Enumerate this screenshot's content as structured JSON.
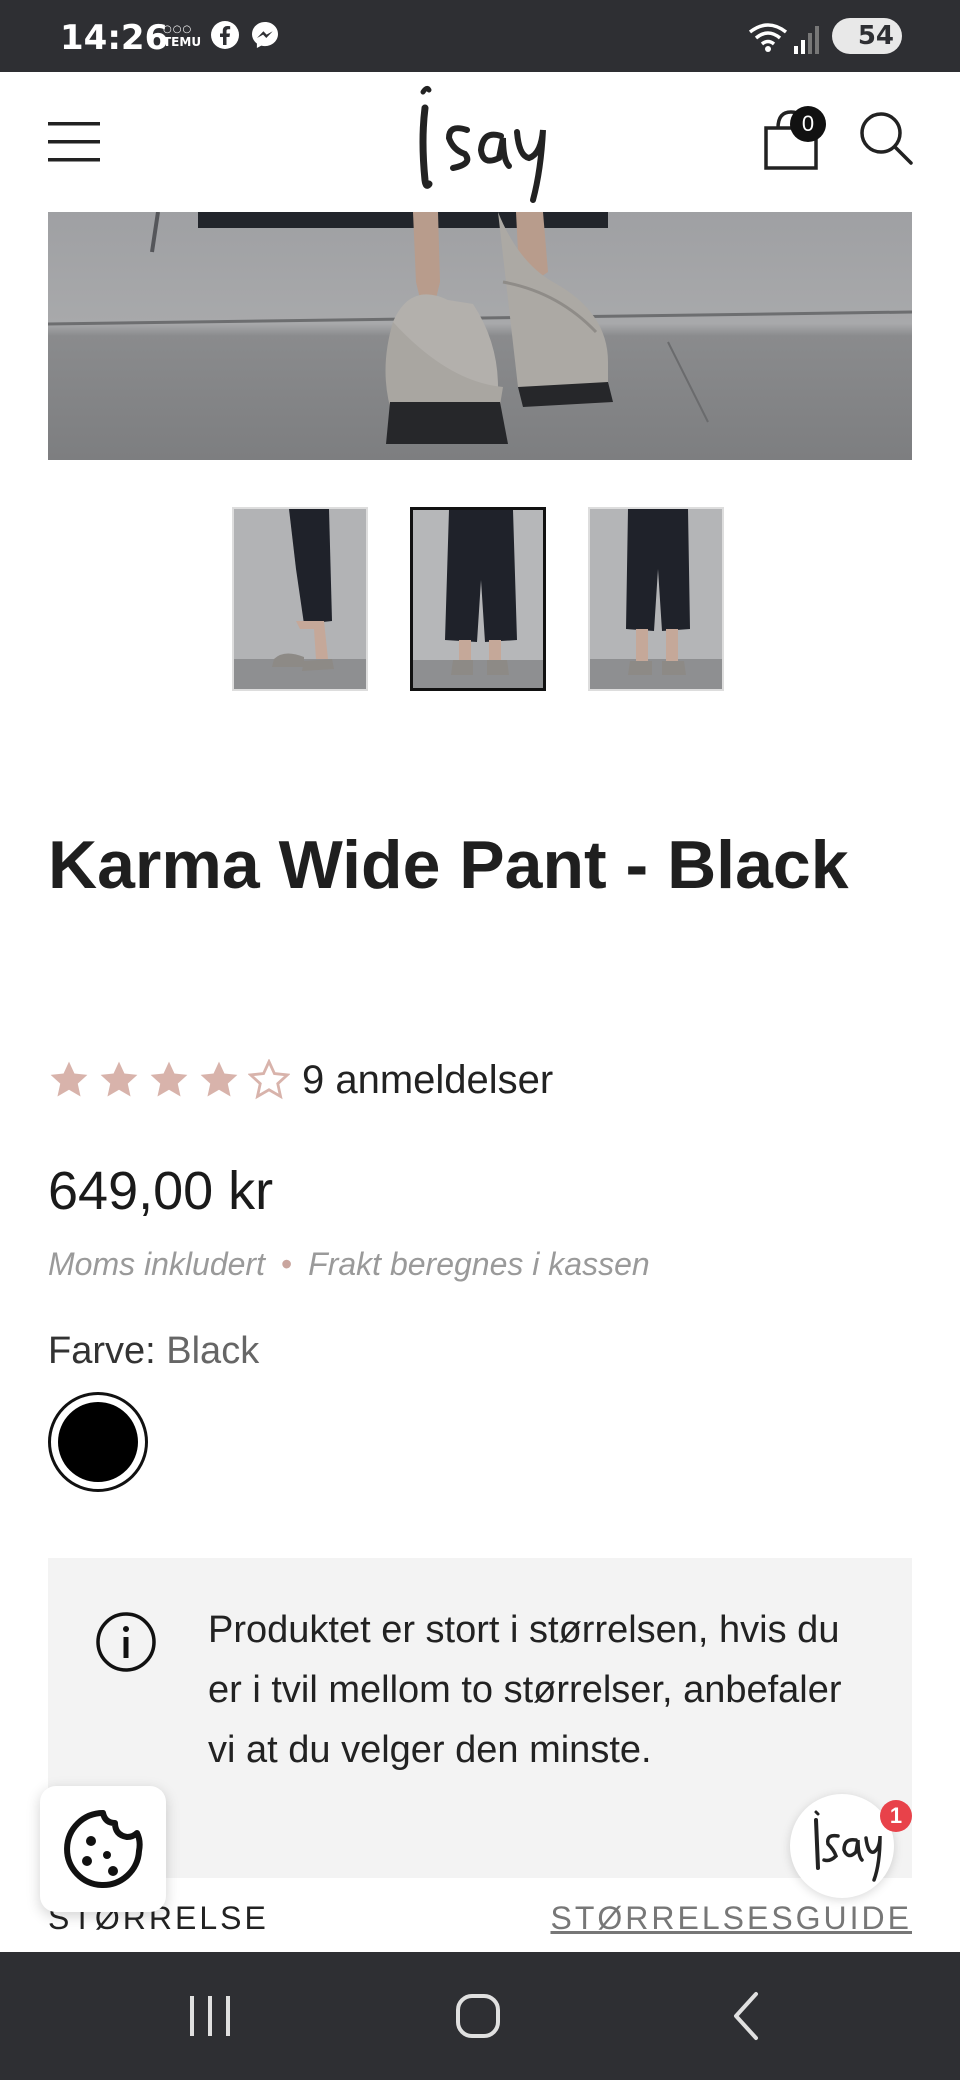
{
  "status_bar": {
    "time": "14:26",
    "app_badge": "TEMU",
    "battery": "54",
    "icons": [
      "temu-icon",
      "facebook-icon",
      "messenger-icon",
      "wifi-icon",
      "signal-icon",
      "battery-icon"
    ]
  },
  "header": {
    "logo_text": "isay",
    "cart_count": "0",
    "icons": [
      "menu-icon",
      "cart-icon",
      "search-icon"
    ]
  },
  "gallery": {
    "thumbnails": [
      "thumb-1",
      "thumb-2",
      "thumb-3"
    ],
    "active_index": 1
  },
  "product": {
    "title": "Karma Wide Pant - Black",
    "rating": 4,
    "rating_max": 5,
    "reviews_label": "9 anmeldelser",
    "price": "649,00 kr",
    "tax_note": "Moms inkludert",
    "shipping_note": "Frakt beregnes i kassen",
    "color_label": "Farve:",
    "color_value": "Black",
    "swatch_color": "#000000",
    "size_note": "Produktet er stort i størrelsen, hvis du er i tvil mellom to størrelser, anbefaler vi at du velger den minste.",
    "size_label": "STØRRELSE",
    "size_guide_label": "STØRRELSESGUIDE"
  },
  "chat": {
    "badge": "1"
  },
  "colors": {
    "star": "#d8b3ab",
    "accent": "#e8424a",
    "bars": "#2e2f33"
  }
}
